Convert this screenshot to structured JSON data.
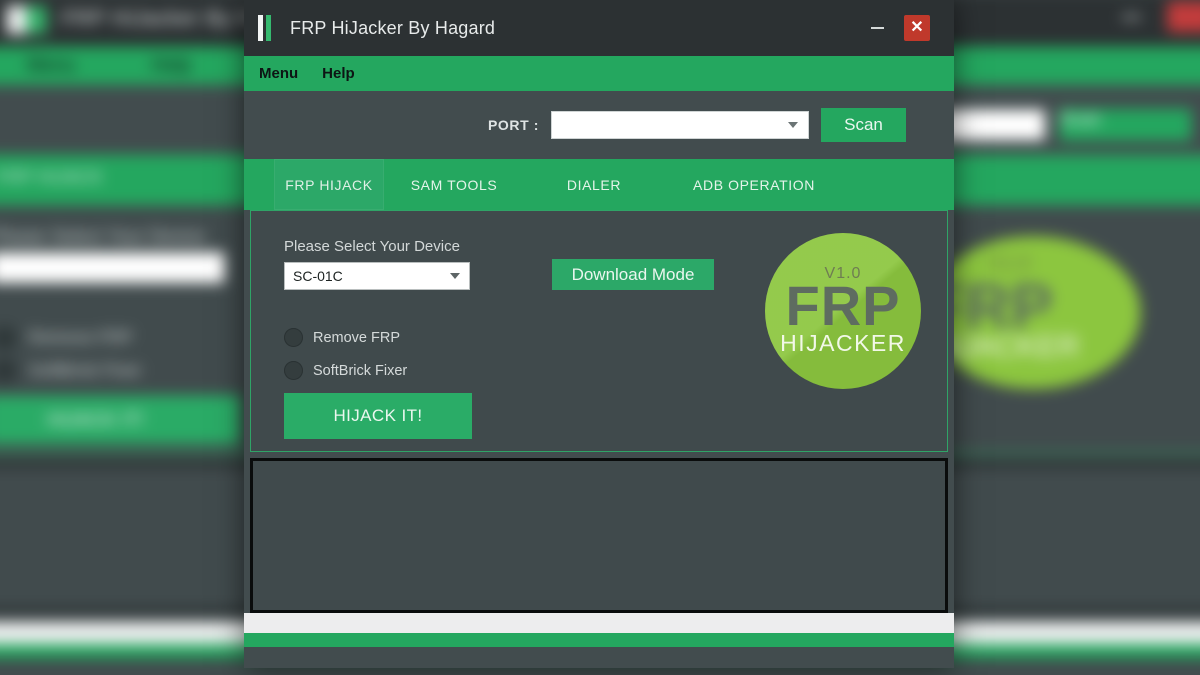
{
  "window": {
    "title": "FRP HiJacker By Hagard",
    "icon": "app-bars-icon",
    "minimize_label": "–",
    "close_label": "✕"
  },
  "menubar": {
    "items": [
      {
        "label": "Menu"
      },
      {
        "label": "Help"
      }
    ]
  },
  "port_row": {
    "label": "PORT :",
    "combo_value": "",
    "combo_placeholder": "",
    "scan_label": "Scan"
  },
  "tabs": [
    {
      "label": "FRP HIJACK",
      "active": true
    },
    {
      "label": "SAM TOOLS",
      "active": false
    },
    {
      "label": "DIALER",
      "active": false
    },
    {
      "label": "ADB OPERATION",
      "active": false
    }
  ],
  "panel": {
    "device_label": "Please Select Your Device",
    "device_value": "SC-01C",
    "download_mode_label": "Download Mode",
    "radios": [
      {
        "label": "Remove FRP",
        "selected": false
      },
      {
        "label": "SoftBrick Fixer",
        "selected": false
      }
    ],
    "hijack_label": "HIJACK IT!"
  },
  "logo": {
    "version": "V1.0",
    "title": "FRP",
    "subtitle": "HIJACKER"
  },
  "log": {
    "content": ""
  },
  "colors": {
    "accent_green": "#24a75f",
    "button_green": "#2ca868",
    "panel_dark": "#404a4c",
    "titlebar_dark": "#2c3133",
    "close_red": "#c0392b",
    "logo_green": "#8cc63f",
    "logo_text": "#5e6c60"
  }
}
